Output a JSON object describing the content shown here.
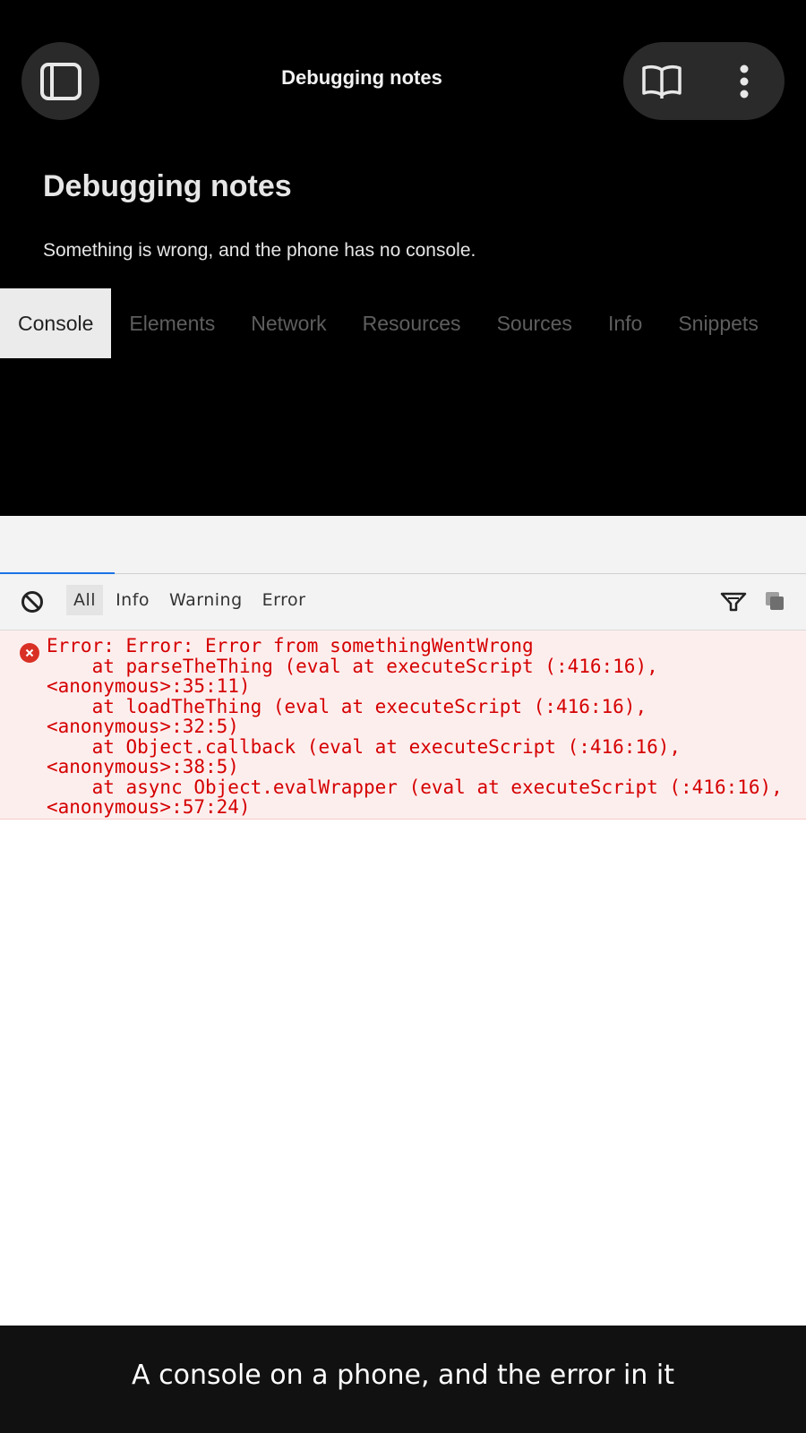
{
  "app_bar": {
    "title": "Debugging notes",
    "icons": [
      "sidebar-icon",
      "book-icon",
      "more-vert-icon"
    ]
  },
  "note": {
    "heading": "Debugging notes",
    "body": "Something is wrong, and the phone has no console."
  },
  "devtools": {
    "tabs": [
      {
        "label": "Console",
        "active": true
      },
      {
        "label": "Elements"
      },
      {
        "label": "Network"
      },
      {
        "label": "Resources"
      },
      {
        "label": "Sources"
      },
      {
        "label": "Info"
      },
      {
        "label": "Snippets"
      }
    ]
  },
  "console": {
    "levels": [
      {
        "label": "All",
        "active": true
      },
      {
        "label": "Info"
      },
      {
        "label": "Warning"
      },
      {
        "label": "Error"
      }
    ],
    "toolbar_icons": [
      "clear-icon",
      "filter-icon",
      "copy-icon"
    ],
    "error_message": "Error: Error: Error from somethingWentWrong\n    at parseTheThing (eval at executeScript (:416:16), <anonymous>:35:11)\n    at loadTheThing (eval at executeScript (:416:16), <anonymous>:32:5)\n    at Object.callback (eval at executeScript (:416:16), <anonymous>:38:5)\n    at async Object.evalWrapper (eval at executeScript (:416:16), <anonymous>:57:24)",
    "error_color": "#d50000",
    "error_bg": "#fdeeee"
  },
  "caption": "A console on a phone, and the error in it"
}
